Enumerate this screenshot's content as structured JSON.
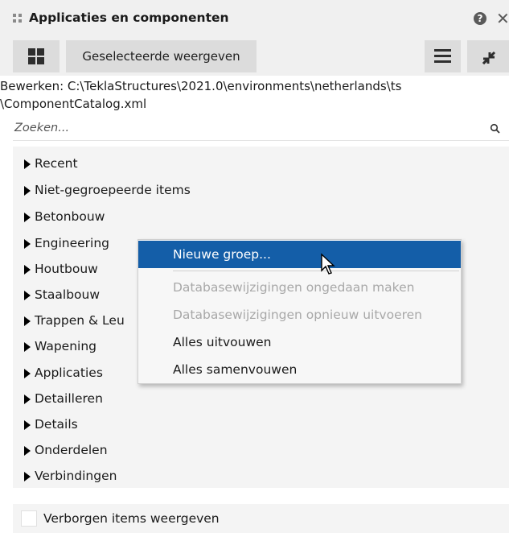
{
  "window": {
    "title": "Applicaties en componenten",
    "grip_icon": "drag-grip-icon",
    "help_icon": "help-icon",
    "help_glyph": "?",
    "close_icon": "close-icon",
    "close_glyph": "✕"
  },
  "toolbar": {
    "grid_icon": "grid-view-icon",
    "select_label": "Geselecteerde weergeven",
    "menu_icon": "hamburger-menu-icon",
    "collapse_icon": "collapse-arrows-icon"
  },
  "path": {
    "line1": "Bewerken:  C:\\TeklaStructures\\2021.0\\environments\\netherlands\\ts",
    "line2": "\\ComponentCatalog.xml"
  },
  "search": {
    "placeholder": "Zoeken...",
    "icon": "search-icon"
  },
  "tree": {
    "items": [
      {
        "label": "Recent"
      },
      {
        "label": "Niet-gegroepeerde items"
      },
      {
        "label": "Betonbouw"
      },
      {
        "label": "Engineering"
      },
      {
        "label": "Houtbouw"
      },
      {
        "label": "Staalbouw"
      },
      {
        "label": "Trappen & Leu"
      },
      {
        "label": "Wapening"
      },
      {
        "label": "Applicaties"
      },
      {
        "label": "Detailleren"
      },
      {
        "label": "Details"
      },
      {
        "label": "Onderdelen"
      },
      {
        "label": "Verbindingen"
      }
    ]
  },
  "footer": {
    "checkbox_label": "Verborgen items weergeven",
    "checked": false
  },
  "context_menu": {
    "items": [
      {
        "label": "Nieuwe groep...",
        "state": "highlighted"
      },
      {
        "label": "Databasewijzigingen ongedaan maken",
        "state": "disabled"
      },
      {
        "label": "Databasewijzigingen opnieuw uitvoeren",
        "state": "disabled"
      },
      {
        "label": "Alles uitvouwen",
        "state": "enabled"
      },
      {
        "label": "Alles samenvouwen",
        "state": "enabled"
      }
    ],
    "highlight_color": "#145ea8",
    "cursor_icon": "mouse-pointer-icon"
  }
}
